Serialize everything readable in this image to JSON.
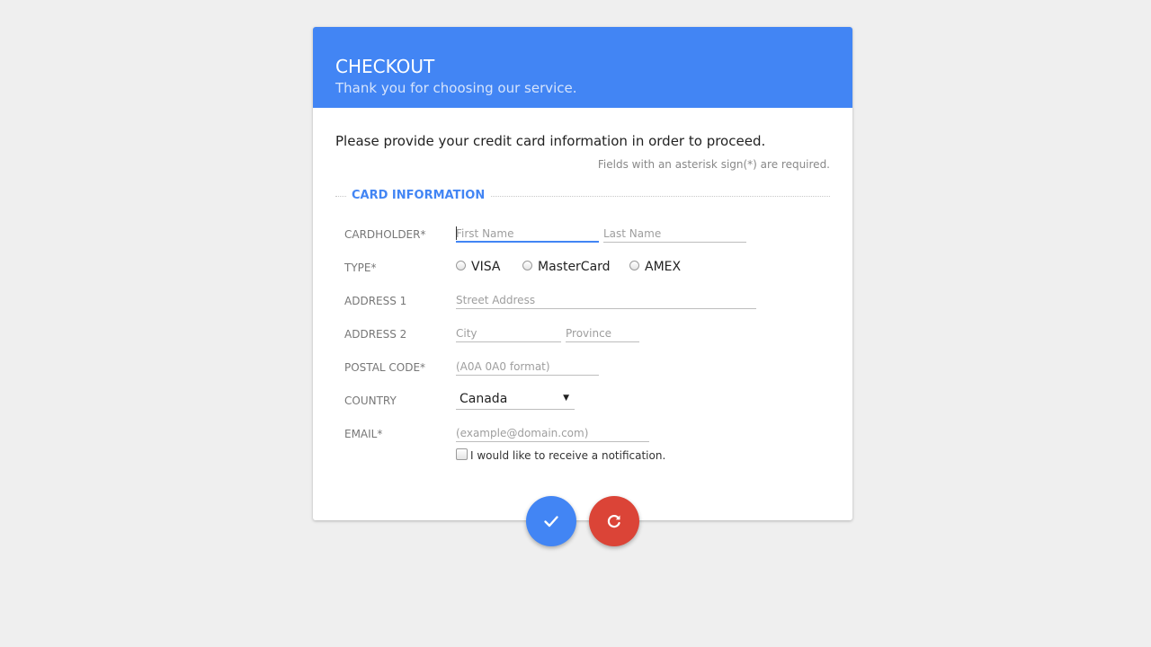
{
  "header": {
    "title": "CHECKOUT",
    "subtitle": "Thank you for choosing our service."
  },
  "intro": "Please provide your credit card information in order to proceed.",
  "required_note": "Fields with an asterisk sign(*) are required.",
  "section_title": "CARD INFORMATION",
  "form": {
    "cardholder": {
      "label": "CARDHOLDER*",
      "first_name_placeholder": "First Name",
      "last_name_placeholder": "Last Name"
    },
    "type": {
      "label": "TYPE*",
      "options": [
        "VISA",
        "MasterCard",
        "AMEX"
      ]
    },
    "address1": {
      "label": "ADDRESS 1",
      "placeholder": "Street Address"
    },
    "address2": {
      "label": "ADDRESS 2",
      "city_placeholder": "City",
      "province_placeholder": "Province"
    },
    "postal": {
      "label": "POSTAL CODE*",
      "placeholder": "(A0A 0A0 format)"
    },
    "country": {
      "label": "COUNTRY",
      "selected": "Canada"
    },
    "email": {
      "label": "EMAIL*",
      "placeholder": "(example@domain.com)"
    },
    "notify_label": "I would like to receive a notification."
  },
  "buttons": {
    "submit_icon": "check-icon",
    "reset_icon": "refresh-icon"
  },
  "colors": {
    "accent": "#4285f4",
    "danger": "#db4437",
    "background": "#efefef"
  }
}
